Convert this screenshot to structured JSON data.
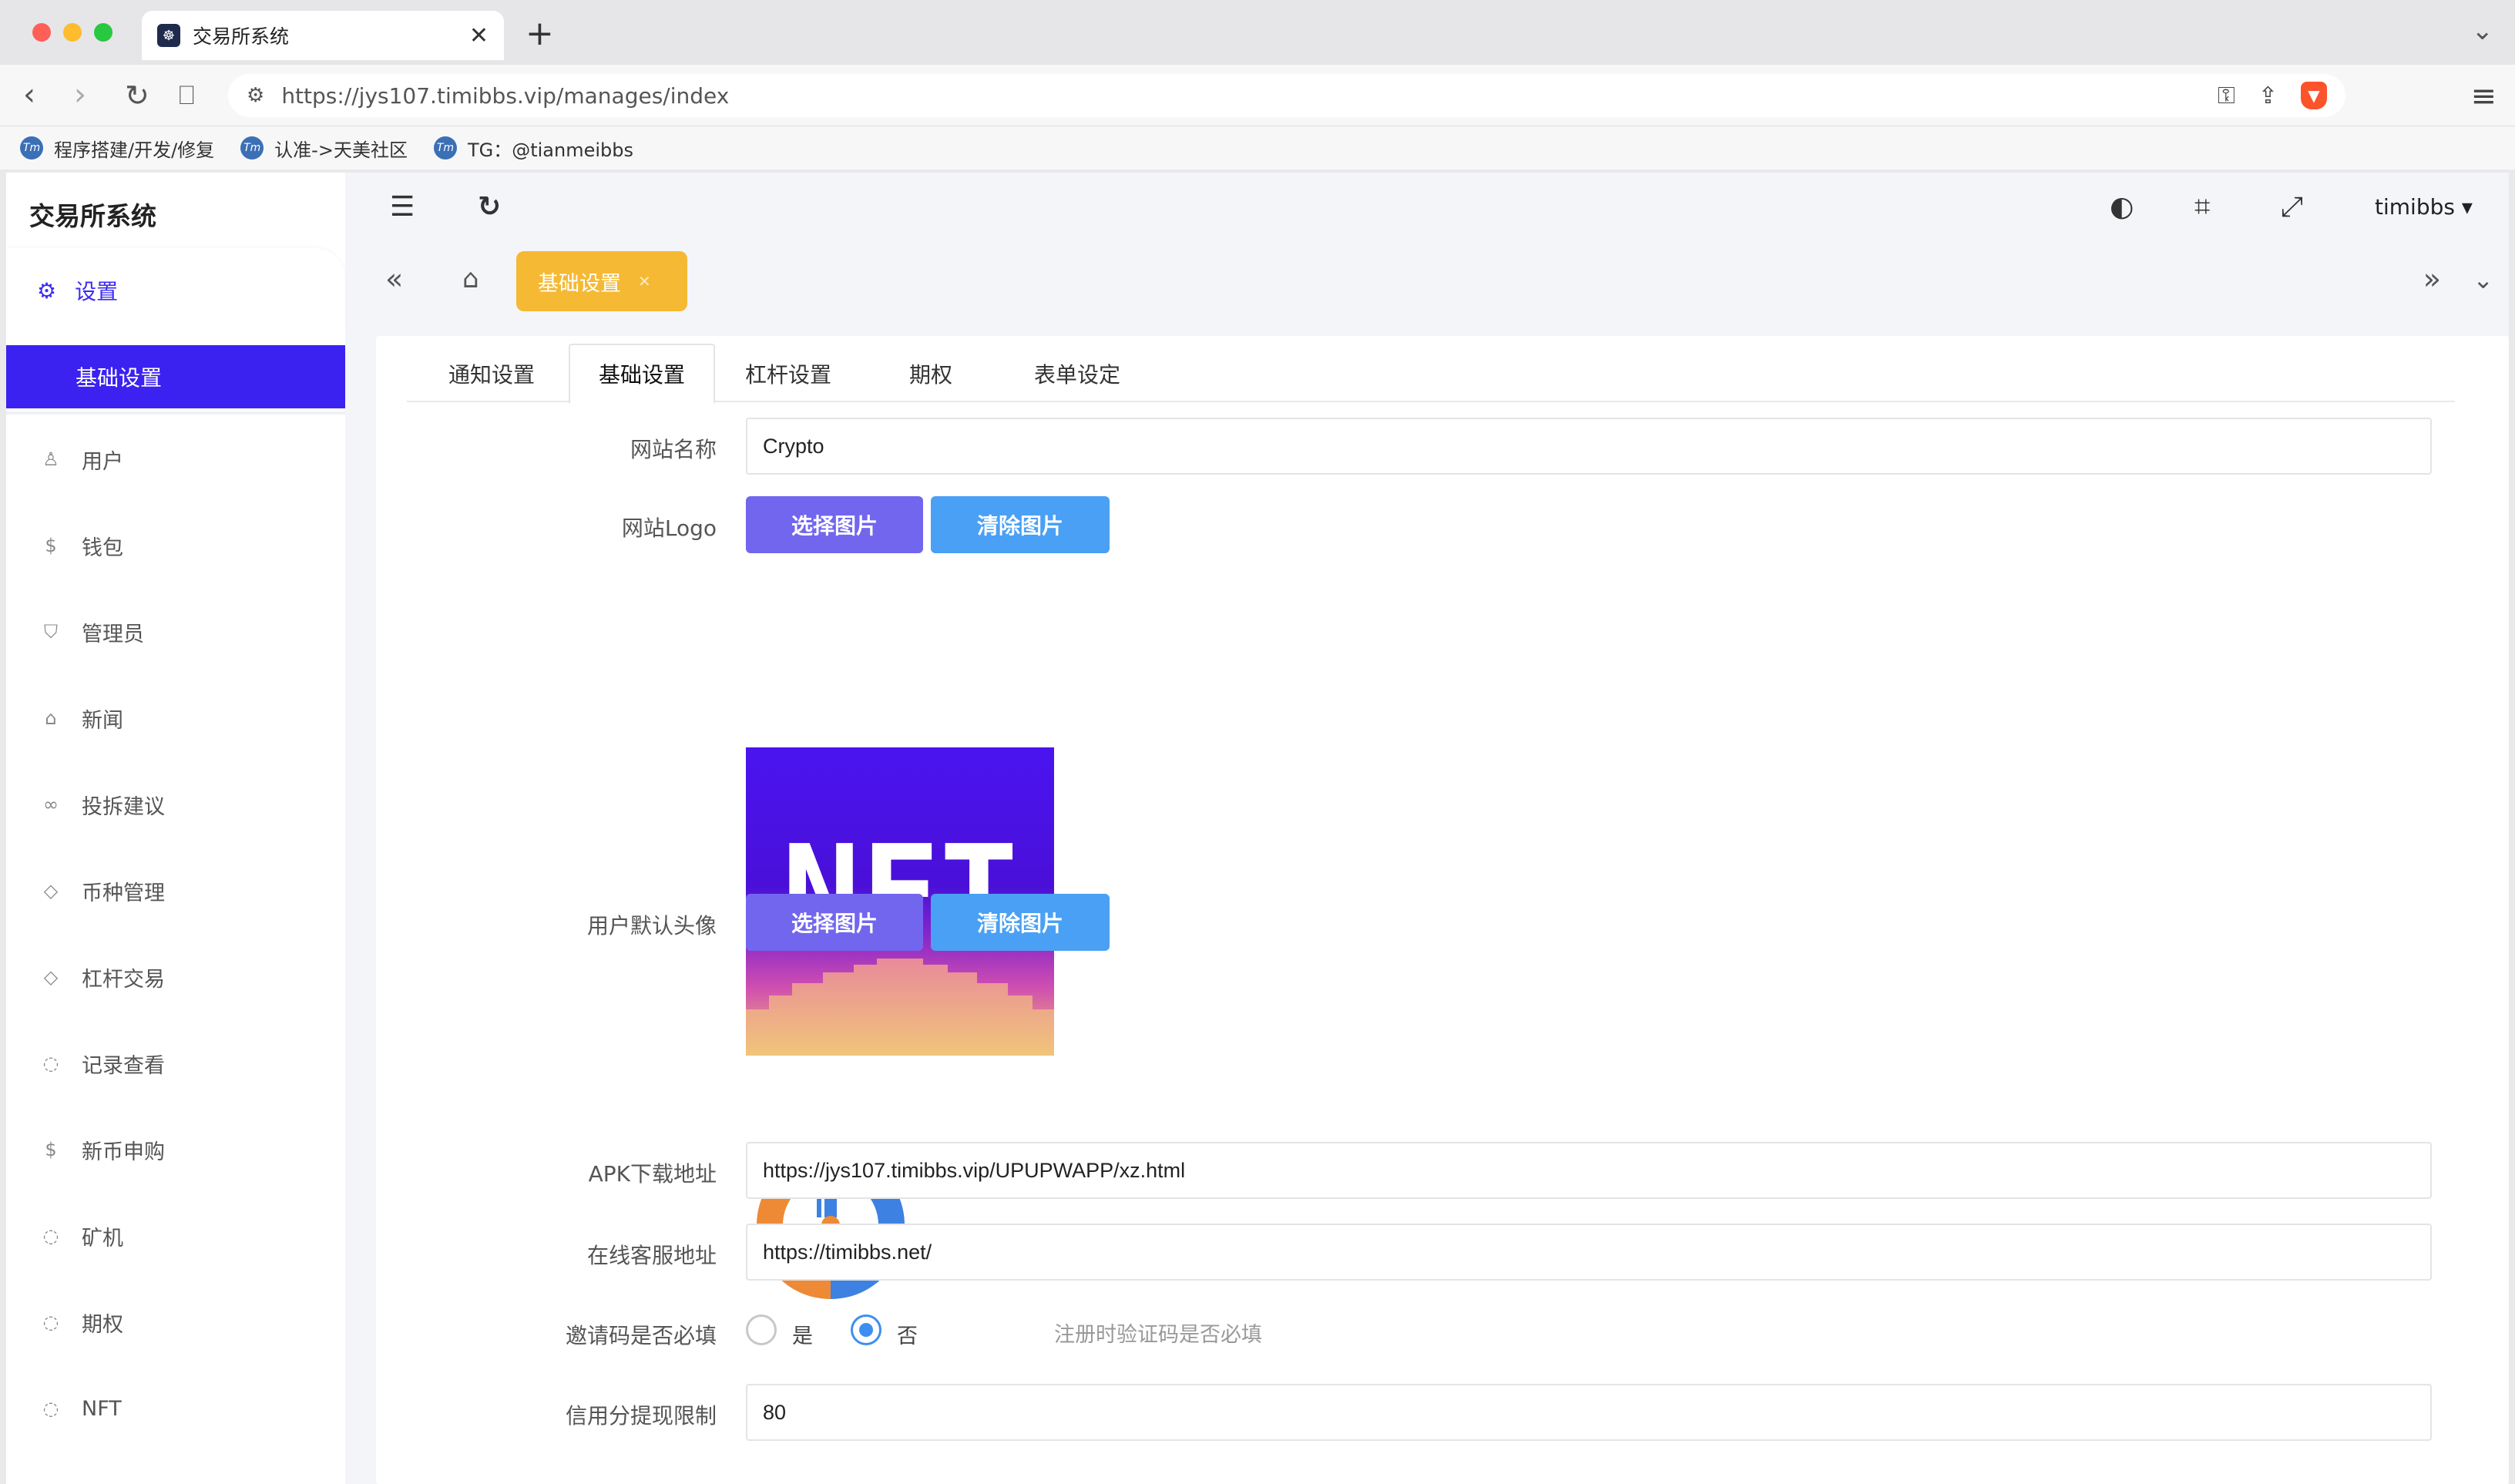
{
  "browser": {
    "tab_title": "交易所系统",
    "url": "https://jys107.timibbs.vip/manages/index",
    "bookmarks": [
      {
        "label": "程序搭建/开发/修复",
        "icon": "Tm"
      },
      {
        "label": "认准->天美社区",
        "icon": "Tm"
      },
      {
        "label": "TG：@tianmeibbs",
        "icon": "Tm"
      }
    ]
  },
  "app": {
    "brand": "交易所系统",
    "user": "timibbs",
    "page_tab": "基础设置"
  },
  "sidebar": {
    "parent": "设置",
    "active": "基础设置",
    "items": [
      {
        "label": "用户",
        "icon": "user-icon"
      },
      {
        "label": "钱包",
        "icon": "dollar-icon"
      },
      {
        "label": "管理员",
        "icon": "shield-icon"
      },
      {
        "label": "新闻",
        "icon": "tag-icon"
      },
      {
        "label": "投拆建议",
        "icon": "link-icon"
      },
      {
        "label": "币种管理",
        "icon": "diamond-icon"
      },
      {
        "label": "杠杆交易",
        "icon": "diamond-icon"
      },
      {
        "label": "记录查看",
        "icon": "circle-icon"
      },
      {
        "label": "新币申购",
        "icon": "dollar-icon"
      },
      {
        "label": "矿机",
        "icon": "circle-icon"
      },
      {
        "label": "期权",
        "icon": "circle-icon"
      },
      {
        "label": "NFT",
        "icon": "circle-icon"
      }
    ]
  },
  "subtabs": [
    "通知设置",
    "基础设置",
    "杠杆设置",
    "期权",
    "表单设定"
  ],
  "form": {
    "site_name_label": "网站名称",
    "site_name_value": "Crypto",
    "logo_label": "网站Logo",
    "choose_label": "选择图片",
    "clear_label": "清除图片",
    "nft_logo_text": "NFT",
    "avatar_label": "用户默认头像",
    "apk_label": "APK下载地址",
    "apk_value": "https://jys107.timibbs.vip/UPUPWAPP/xz.html",
    "service_label": "在线客服地址",
    "service_value": "https://timibbs.net/",
    "invite_label": "邀请码是否必填",
    "invite_yes": "是",
    "invite_no": "否",
    "invite_hint": "注册时验证码是否必填",
    "credit_label": "信用分提现限制",
    "credit_value": "80"
  },
  "colors": {
    "accent": "#3b22f0",
    "page_tab": "#f5b933",
    "choose_btn": "#7266ee",
    "clear_btn": "#4aa0f4"
  }
}
